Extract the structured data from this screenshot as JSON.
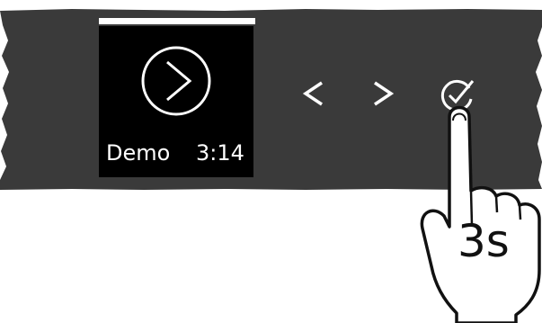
{
  "colors": {
    "panel": "#3a3a3a",
    "display": "#000000",
    "foreground": "#ffffff",
    "hand_outline": "#111111"
  },
  "display": {
    "indicator": "display-top-bar",
    "play_icon": "play-circle-icon",
    "program_name": "Demo",
    "program_time": "3:14"
  },
  "controls": {
    "prev_icon": "chevron-left-icon",
    "next_icon": "chevron-right-icon",
    "confirm_icon": "check-circle-icon"
  },
  "instruction": {
    "icon": "pointing-hand-icon",
    "hold_duration": "3s"
  }
}
